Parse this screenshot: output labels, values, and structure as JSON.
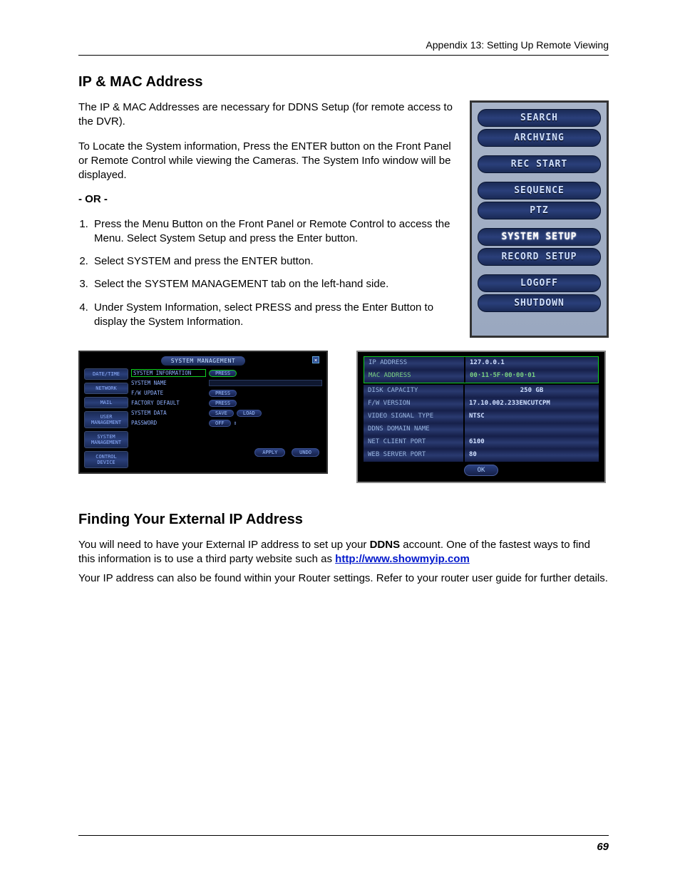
{
  "header": "Appendix 13: Setting Up Remote Viewing",
  "page_num": "69",
  "section1": {
    "title": "IP & MAC Address",
    "p1": "The IP & MAC Addresses are necessary for DDNS Setup (for remote access to the DVR).",
    "p2": "To Locate the System information, Press the ENTER button on the Front Panel or Remote Control while viewing the Cameras. The System Info window will be displayed.",
    "or": "- OR -",
    "steps": [
      "Press the Menu Button on the Front Panel or Remote Control to access the Menu. Select System Setup and press the Enter button.",
      "Select SYSTEM and press the ENTER button.",
      "Select the SYSTEM MANAGEMENT tab on the left-hand side.",
      "Under System Information, select PRESS and press the Enter Button to display the System Information."
    ]
  },
  "menu": {
    "items": [
      "SEARCH",
      "ARCHVING",
      "REC START",
      "SEQUENCE",
      "PTZ",
      "SYSTEM SETUP",
      "RECORD SETUP",
      "LOGOFF",
      "SHUTDOWN"
    ],
    "selected": 5
  },
  "sm": {
    "title": "SYSTEM MANAGEMENT",
    "tabs": [
      "DATE/TIME",
      "NETWORK",
      "MAIL",
      "USER MANAGEMENT",
      "SYSTEM MANAGEMENT",
      "CONTROL DEVICE"
    ],
    "rows": {
      "sysinfo": {
        "label": "SYSTEM INFORMATION",
        "btn": "PRESS"
      },
      "sysname": {
        "label": "SYSTEM NAME"
      },
      "fwupdate": {
        "label": "F/W UPDATE",
        "btn": "PRESS"
      },
      "factory": {
        "label": "FACTORY DEFAULT",
        "btn": "PRESS"
      },
      "sysdata": {
        "label": "SYSTEM DATA",
        "b1": "SAVE",
        "b2": "LOAD"
      },
      "password": {
        "label": "PASSWORD",
        "btn": "OFF"
      }
    },
    "footer": {
      "apply": "APPLY",
      "undo": "UNDO"
    }
  },
  "si": {
    "rows": [
      {
        "k": "IP ADDRESS",
        "v": "127.0.0.1"
      },
      {
        "k": "MAC ADDRESS",
        "v": "00·11·5F·00·00·01"
      },
      {
        "k": "DISK CAPACITY",
        "v": "250 GB"
      },
      {
        "k": "F/W VERSION",
        "v": "17.10.002.233ENCUTCPM"
      },
      {
        "k": "VIDEO SIGNAL TYPE",
        "v": "NTSC"
      },
      {
        "k": "DDNS DOMAIN NAME",
        "v": ""
      },
      {
        "k": "NET CLIENT PORT",
        "v": "6100"
      },
      {
        "k": "WEB SERVER PORT",
        "v": "80"
      }
    ],
    "ok": "OK"
  },
  "section2": {
    "title": "Finding Your External IP Address",
    "p1a": "You will need to have your External IP address to set up your ",
    "p1b": "DDNS",
    "p1c": " account. One of the fastest ways to find this information is to use a third party website such as ",
    "link": "http://www.showmyip.com",
    "p2": "Your IP address can also be found within your Router settings. Refer to your router user guide for further details."
  }
}
